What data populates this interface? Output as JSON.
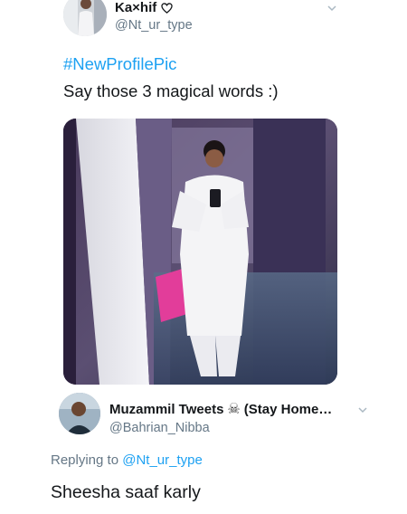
{
  "tweet": {
    "display_name": "Ka×hif",
    "handle": "@Nt_ur_type",
    "hashtag": "#NewProfilePic",
    "text": "Say those 3 magical words :)",
    "icons": {
      "name_badge": "heart-outline-icon",
      "menu": "chevron-down-icon"
    }
  },
  "reply": {
    "display_name": "Muzammil Tweets",
    "name_emoji": "☠",
    "name_suffix": "(Stay Home…",
    "handle": "@Bahrian_Nibba",
    "replying_prefix": "Replying to",
    "replying_handle": "@Nt_ur_type",
    "text": "Sheesha saaf karly",
    "icons": {
      "menu": "chevron-down-icon"
    }
  },
  "colors": {
    "link": "#1da1f2",
    "secondary_text": "#657786",
    "primary_text": "#14171a"
  }
}
